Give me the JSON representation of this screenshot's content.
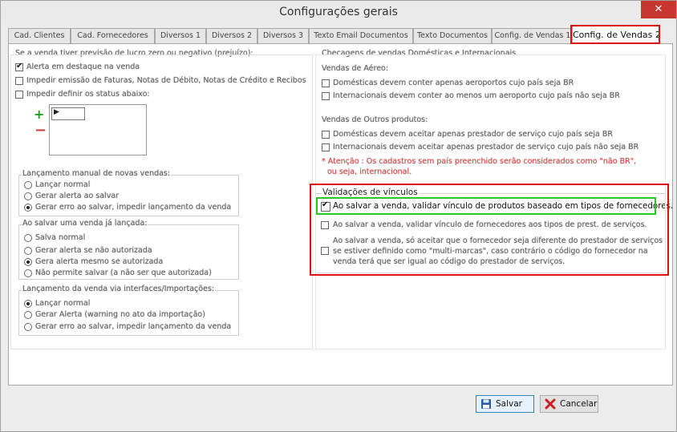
{
  "window": {
    "title": "Configurações gerais",
    "close_glyph": "✕"
  },
  "tabs": [
    {
      "label": "Cad. Clientes",
      "active": false
    },
    {
      "label": "Cad. Fornecedores",
      "active": false
    },
    {
      "label": "Diversos 1",
      "active": false
    },
    {
      "label": "Diversos 2",
      "active": false
    },
    {
      "label": "Diversos 3",
      "active": false
    },
    {
      "label": "Texto Email Documentos",
      "active": false
    },
    {
      "label": "Texto Documentos",
      "active": false
    },
    {
      "label": "Config. de Vendas 1",
      "active": false
    },
    {
      "label": "Config. de Vendas 2",
      "active": true
    }
  ],
  "left": {
    "profit_title": "Se a venda tiver previsão de lucro zero ou negativo (prejuízo):",
    "profit_options": [
      {
        "label": "Alerta em destaque na venda",
        "checked": true
      },
      {
        "label": "Impedir emissão de Faturas, Notas de Débito, Notas de Crédito e Recibos",
        "checked": false
      },
      {
        "label": "Impedir definir os status abaixo:",
        "checked": false
      }
    ],
    "status_cell_value": "▶",
    "manual": {
      "title": "Lançamento manual de novas vendas:",
      "options": [
        {
          "label": "Lançar normal",
          "checked": false
        },
        {
          "label": "Gerar alerta ao salvar",
          "checked": false
        },
        {
          "label": "Gerar erro ao salvar, impedir lançamento da venda",
          "checked": true
        }
      ]
    },
    "saving": {
      "title": "Ao salvar uma venda já lançada:",
      "options": [
        {
          "label": "Salva normal",
          "checked": false
        },
        {
          "label": "Gerar alerta se não autorizada",
          "checked": false
        },
        {
          "label": "Gera alerta mesmo se autorizada",
          "checked": true
        },
        {
          "label": "Não permite salvar (a não ser que autorizada)",
          "checked": false
        }
      ]
    },
    "interfaces": {
      "title": "Lançamento da venda via interfaces/Importações:",
      "options": [
        {
          "label": "Lançar normal",
          "checked": true
        },
        {
          "label": "Gerar Alerta (warning no ato da importação)",
          "checked": false
        },
        {
          "label": "Gerar erro ao salvar, impedir lançamento da venda",
          "checked": false
        }
      ]
    }
  },
  "right": {
    "checks_title": "Checagens de vendas Domésticas e Internacionais",
    "air_title": "Vendas de Aéreo:",
    "air_options": [
      {
        "label": "Domésticas devem conter apenas aeroportos cujo país seja BR",
        "checked": false
      },
      {
        "label": "Internacionais devem conter ao menos um aeroporto cujo país não seja BR",
        "checked": false
      }
    ],
    "other_title": "Vendas de Outros produtos:",
    "other_options": [
      {
        "label": "Domésticas devem aceitar apenas prestador de serviço cujo país seja BR",
        "checked": false
      },
      {
        "label": "Internacionais devem aceitar apenas prestador de serviço cujo país não seja BR",
        "checked": false
      }
    ],
    "warning_line1": "* Atenção : Os cadastros sem país preenchido serão considerados como \"não BR\",",
    "warning_line2": "ou seja, internacional.",
    "validations": {
      "title": "Validações de vínculos",
      "opt1": "Ao salvar a venda, validar vínculo de produtos baseado em tipos de fornecedores.",
      "opt2": "Ao salvar a venda, validar vínculo de fornecedores aos tipos de prest. de serviços.",
      "opt3_line1": "Ao salvar a venda, só aceitar que o fornecedor seja diferente do prestador de serviços",
      "opt3_line2": "se estiver definido como \"multi-marcas\", caso contrário o código do fornecedor na",
      "opt3_line3": "venda terá que ser igual ao código do prestador de serviços.",
      "opt1_checked": true,
      "opt2_checked": false,
      "opt3_checked": false
    }
  },
  "buttons": {
    "save": "Salvar",
    "cancel": "Cancelar"
  },
  "colors": {
    "highlight_red": "#e01010",
    "highlight_green": "#28c828",
    "warning_text": "#e02020"
  }
}
